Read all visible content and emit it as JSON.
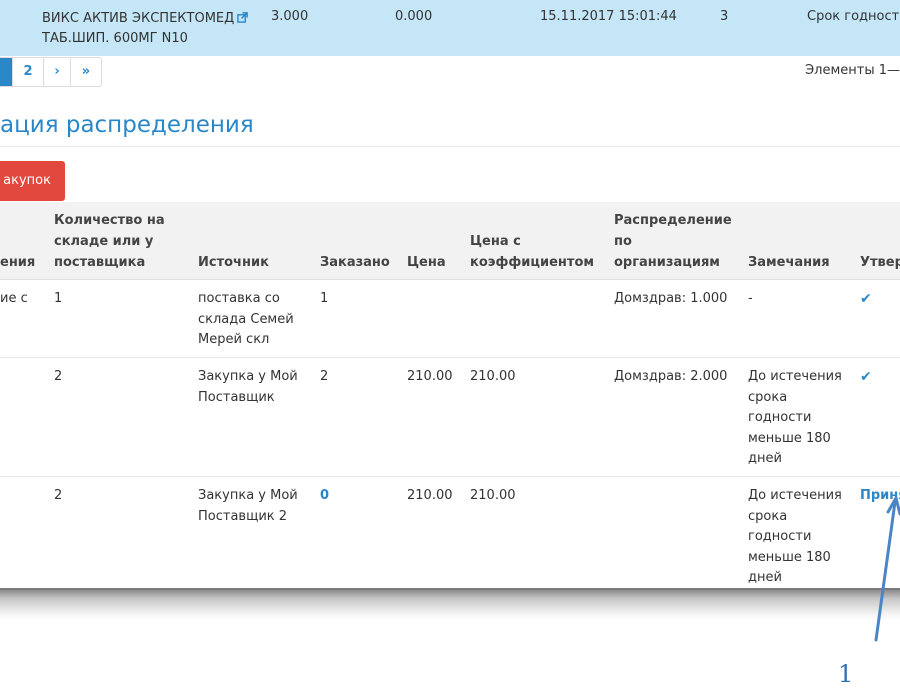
{
  "top_row": {
    "name_line1": "ВИКС АКТИВ ЭКСПЕКТОМЕД",
    "name_line2": "ТАБ.ШИП. 600МГ N10",
    "qty": "3.000",
    "ordered": "0.000",
    "datetime": "15.11.2017 15:01:44",
    "count": "3",
    "remark": "Срок годност"
  },
  "pager": {
    "page2": "2",
    "next": "›",
    "last": "»",
    "items_info": "Элементы 1—"
  },
  "section": {
    "title": "ация распределения",
    "button_label": "акупок"
  },
  "table": {
    "headers": {
      "c0": "ения",
      "c1": [
        "Количество на",
        "складе или у",
        "поставщика"
      ],
      "c2": "Источник",
      "c3": "Заказано",
      "c4": "Цена",
      "c5": [
        "Цена с",
        "коэффициентом"
      ],
      "c6": [
        "Распределение",
        "по",
        "организациям"
      ],
      "c7": "Замечания",
      "c8": "Утвер"
    },
    "rows": [
      {
        "c0": "ие с",
        "c1": "1",
        "c2": [
          "поставка со",
          "склада Семей",
          "Мерей скл"
        ],
        "c3": "1",
        "c4": "",
        "c5": "",
        "c6": "Домздрав: 1.000",
        "c7": [
          "-"
        ],
        "c8": "✔"
      },
      {
        "c0": "",
        "c1": "2",
        "c2": [
          "Закупка у Мой",
          "Поставщик"
        ],
        "c3": "2",
        "c4": "210.00",
        "c5": "210.00",
        "c6": "Домздрав: 2.000",
        "c7": [
          "До истечения",
          "срока",
          "годности",
          "меньше 180",
          "дней"
        ],
        "c8": "✔"
      },
      {
        "c0": "",
        "c1": "2",
        "c2": [
          "Закупка у Мой",
          "Поставщик 2"
        ],
        "c3": "0",
        "c4": "210.00",
        "c5": "210.00",
        "c6": "",
        "c7": [
          "До истечения",
          "срока",
          "годности",
          "меньше 180",
          "дней"
        ],
        "c8": "Приня"
      }
    ]
  },
  "annotation": {
    "number": "1"
  },
  "colors": {
    "accent": "#2a87c8",
    "highlight_row": "#c4e6f7",
    "danger_button": "#e2483d"
  }
}
